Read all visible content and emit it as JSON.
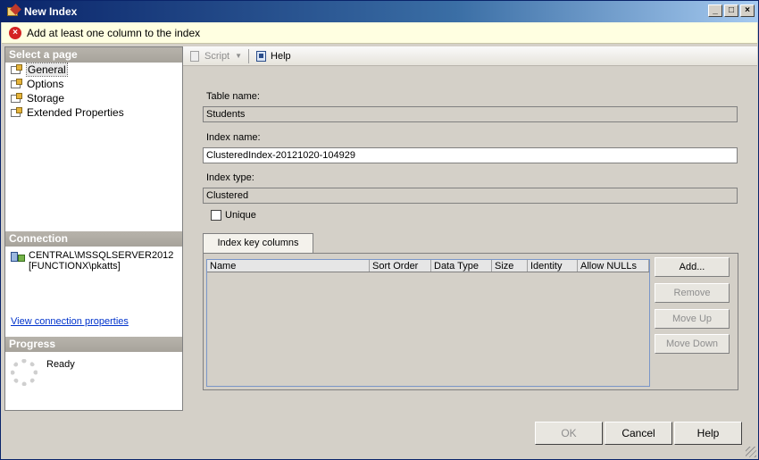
{
  "window": {
    "title": "New Index"
  },
  "banner": {
    "message": "Add at least one column to the index"
  },
  "leftpane": {
    "select_page_header": "Select a page",
    "pages": [
      {
        "label": "General",
        "selected": true
      },
      {
        "label": "Options",
        "selected": false
      },
      {
        "label": "Storage",
        "selected": false
      },
      {
        "label": "Extended Properties",
        "selected": false
      }
    ],
    "connection_header": "Connection",
    "connection_server": "CENTRAL\\MSSQLSERVER2012",
    "connection_user": "[FUNCTIONX\\pkatts]",
    "connection_link": "View connection properties",
    "progress_header": "Progress",
    "progress_status": "Ready"
  },
  "toolbar": {
    "script_label": "Script",
    "help_label": "Help"
  },
  "form": {
    "table_name_label": "Table name:",
    "table_name_value": "Students",
    "index_name_label": "Index name:",
    "index_name_value": "ClusteredIndex-20121020-104929",
    "index_type_label": "Index type:",
    "index_type_value": "Clustered",
    "unique_label": "Unique",
    "unique_checked": false
  },
  "key_columns": {
    "tab_label": "Index key columns",
    "columns": [
      "Name",
      "Sort Order",
      "Data Type",
      "Size",
      "Identity",
      "Allow NULLs"
    ],
    "rows": [],
    "buttons": {
      "add": "Add...",
      "remove": "Remove",
      "move_up": "Move Up",
      "move_down": "Move Down"
    }
  },
  "footer": {
    "ok": "OK",
    "cancel": "Cancel",
    "help": "Help"
  }
}
